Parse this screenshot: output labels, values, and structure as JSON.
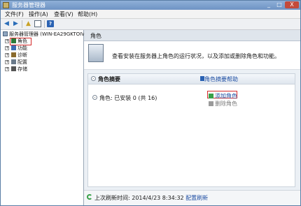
{
  "window": {
    "title": "服务器管理器",
    "min_label": "_",
    "max_label": "□",
    "close_label": "X"
  },
  "menu": [
    "文件(F)",
    "操作(A)",
    "查看(V)",
    "帮助(H)"
  ],
  "toolbar": {
    "back": "◀",
    "forward": "▶",
    "up": "▲",
    "help": "?"
  },
  "tree": {
    "root": "服务器管理器 (WIN-EA29GKTOIV",
    "items": [
      {
        "label": "角色",
        "expander": "+",
        "icon": "roles-icon",
        "color": "#2d7a3a"
      },
      {
        "label": "功能",
        "expander": "+",
        "icon": "features-icon",
        "color": "#3d6db5"
      },
      {
        "label": "诊断",
        "expander": "+",
        "icon": "diagnostics-icon",
        "color": "#8a6b2e"
      },
      {
        "label": "配置",
        "expander": "+",
        "icon": "configuration-icon",
        "color": "#6a7a8a"
      },
      {
        "label": "存储",
        "expander": "+",
        "icon": "storage-icon",
        "color": "#555555"
      }
    ]
  },
  "content": {
    "header": "角色",
    "banner_text": "查看安装在服务器上角色的运行状况，以及添加或删除角色和功能。",
    "panel": {
      "title": "角色摘要",
      "help_link": "角色摘要帮助",
      "roles_line": "角色: 已安装 0 (共 16)",
      "actions": [
        "添加角色",
        "删除角色"
      ],
      "collapse_symbol": "-"
    },
    "status": {
      "prefix": "上次刷新时间: 2014/4/23 8:34:32",
      "config_link": "配置刷新"
    }
  },
  "colors": {
    "accent": "#1f4fa3",
    "selection_box": "#d42b2b",
    "refresh_green": "#3aa14a"
  }
}
